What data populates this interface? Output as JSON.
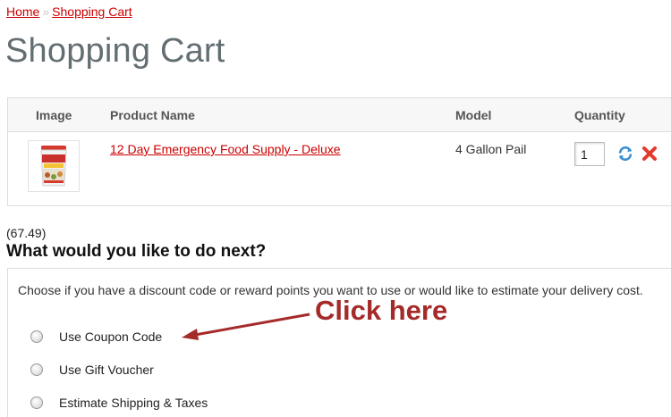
{
  "breadcrumb": {
    "home": "Home",
    "separator": "»",
    "current": "Shopping Cart"
  },
  "page_title": "Shopping Cart",
  "cart": {
    "headers": {
      "image": "Image",
      "name": "Product Name",
      "model": "Model",
      "quantity": "Quantity"
    },
    "items": [
      {
        "name": "12 Day Emergency Food Supply - Deluxe",
        "model": "4 Gallon Pail",
        "quantity": "1"
      }
    ]
  },
  "total_note": "(67.49)",
  "next_heading": "What would you like to do next?",
  "options": {
    "description": "Choose if you have a discount code or reward points you want to use or would like to estimate your delivery cost.",
    "items": [
      {
        "label": "Use Coupon Code"
      },
      {
        "label": "Use Gift Voucher"
      },
      {
        "label": "Estimate Shipping & Taxes"
      }
    ]
  },
  "annotation": {
    "text": "Click here"
  },
  "icons": {
    "update": "refresh-icon",
    "remove": "remove-icon"
  },
  "colors": {
    "link": "#cc0000",
    "title": "#636e73",
    "annotation": "#a52a2a",
    "update_icon": "#3a8fd1",
    "remove_icon": "#e23b2e"
  }
}
